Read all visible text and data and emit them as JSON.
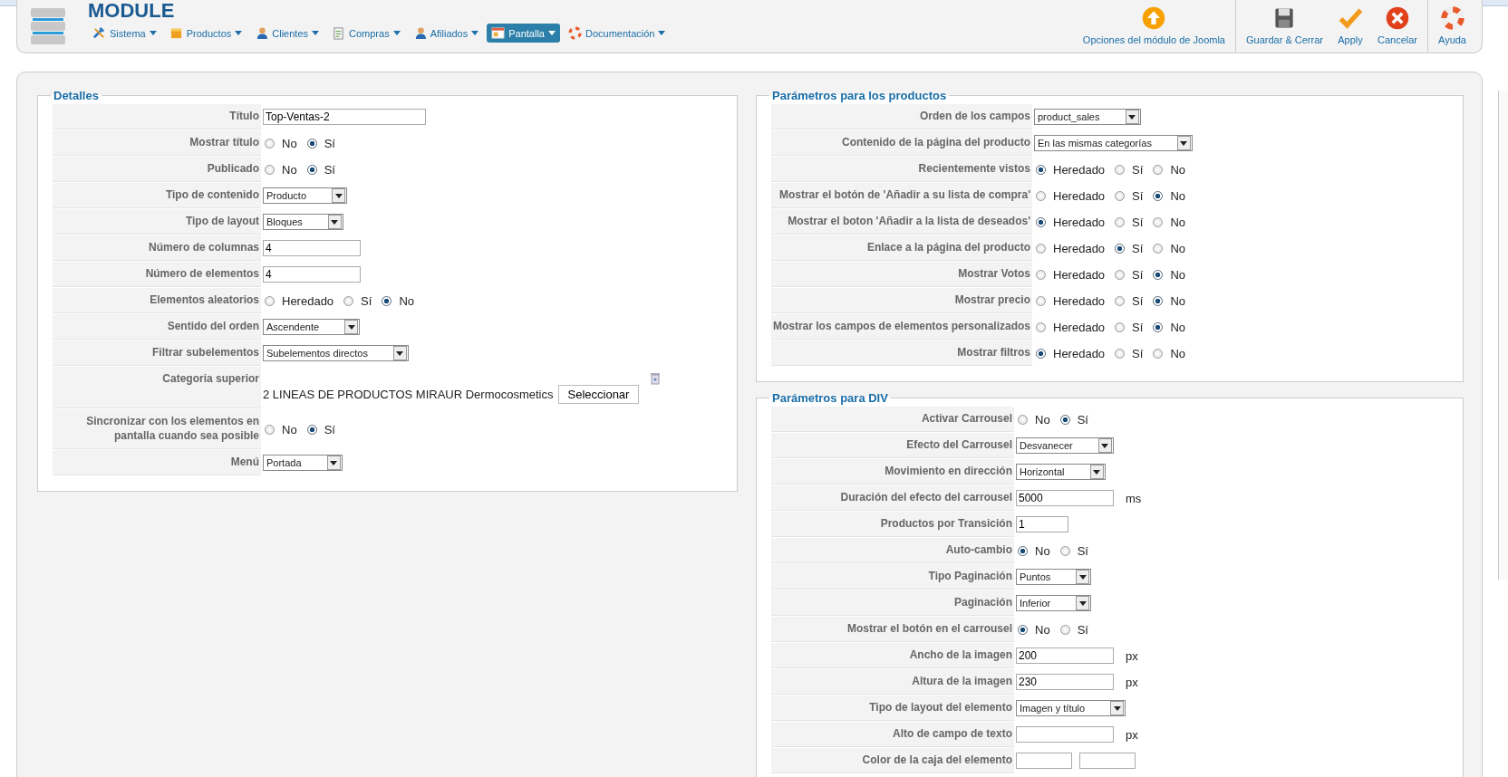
{
  "header": {
    "title": "MODULE",
    "menu": [
      {
        "label": "Sistema",
        "selected": false
      },
      {
        "label": "Productos",
        "selected": false
      },
      {
        "label": "Clientes",
        "selected": false
      },
      {
        "label": "Compras",
        "selected": false
      },
      {
        "label": "Afiliados",
        "selected": false
      },
      {
        "label": "Pantalla",
        "selected": true
      },
      {
        "label": "Documentación",
        "selected": false
      }
    ]
  },
  "toolbar": [
    [
      {
        "label": "Opciones del módulo de Joomla",
        "kind": "options"
      }
    ],
    [
      {
        "label": "Guardar & Cerrar",
        "kind": "save"
      },
      {
        "label": "Apply",
        "kind": "apply"
      },
      {
        "label": "Cancelar",
        "kind": "cancel"
      }
    ],
    [
      {
        "label": "Ayuda",
        "kind": "help"
      }
    ]
  ],
  "panels": [
    {
      "title": "Detalles",
      "rows": [
        {
          "label": "Título",
          "kind": "text",
          "value": "Top-Ventas-2"
        },
        {
          "label": "Mostrar título",
          "kind": "radio",
          "options": [
            {
              "label": "No",
              "selected": false
            },
            {
              "label": "Sí",
              "selected": true
            }
          ]
        },
        {
          "label": "Publicado",
          "kind": "radio",
          "options": [
            {
              "label": "No",
              "selected": false
            },
            {
              "label": "Sí",
              "selected": true
            }
          ]
        },
        {
          "label": "Tipo de contenido",
          "kind": "select",
          "value": "Producto"
        },
        {
          "label": "Tipo de layout",
          "kind": "select",
          "value": "Bloques"
        },
        {
          "label": "Número de columnas",
          "kind": "text",
          "value": "4"
        },
        {
          "label": "Número de elementos",
          "kind": "text",
          "value": "4"
        },
        {
          "label": "Elementos aleatorios",
          "kind": "radio",
          "options": [
            {
              "label": "Heredado",
              "selected": false
            },
            {
              "label": "Sí",
              "selected": false
            },
            {
              "label": "No",
              "selected": true
            }
          ]
        },
        {
          "label": "Sentido del orden",
          "kind": "select",
          "value": "Ascendente"
        },
        {
          "label": "Filtrar subelementos",
          "kind": "select",
          "value": "Subelementos directos"
        },
        {
          "label": "Categoria superior",
          "kind": "category",
          "value": "2 LINEAS DE PRODUCTOS MIRAUR Dermocosmetics",
          "button": "Seleccionar"
        },
        {
          "label": "Sincronizar con los elementos en pantalla cuando sea posible",
          "kind": "radio",
          "options": [
            {
              "label": "No",
              "selected": false
            },
            {
              "label": "Sí",
              "selected": true
            }
          ]
        },
        {
          "label": "Menú",
          "kind": "select",
          "value": "Portada"
        }
      ]
    },
    {
      "title": "Parámetros para los productos",
      "rows": [
        {
          "label": "Orden de los campos",
          "kind": "select",
          "value": "product_sales"
        },
        {
          "label": "Contenido de la página del producto",
          "kind": "select",
          "value": "En las mismas categorías"
        },
        {
          "label": "Recientemente vistos",
          "kind": "radio",
          "options": [
            {
              "label": "Heredado",
              "selected": true
            },
            {
              "label": "Sí",
              "selected": false
            },
            {
              "label": "No",
              "selected": false
            }
          ]
        },
        {
          "label": "Mostrar el botón de 'Añadir a su lista de compra'",
          "kind": "radio",
          "options": [
            {
              "label": "Heredado",
              "selected": false
            },
            {
              "label": "Sí",
              "selected": false
            },
            {
              "label": "No",
              "selected": true
            }
          ]
        },
        {
          "label": "Mostrar el boton 'Añadir a la lista de deseados'",
          "kind": "radio",
          "options": [
            {
              "label": "Heredado",
              "selected": true
            },
            {
              "label": "Sí",
              "selected": false
            },
            {
              "label": "No",
              "selected": false
            }
          ]
        },
        {
          "label": "Enlace a la página del producto",
          "kind": "radio",
          "options": [
            {
              "label": "Heredado",
              "selected": false
            },
            {
              "label": "Sí",
              "selected": true
            },
            {
              "label": "No",
              "selected": false
            }
          ]
        },
        {
          "label": "Mostrar Votos",
          "kind": "radio",
          "options": [
            {
              "label": "Heredado",
              "selected": false
            },
            {
              "label": "Sí",
              "selected": false
            },
            {
              "label": "No",
              "selected": true
            }
          ]
        },
        {
          "label": "Mostrar precio",
          "kind": "radio",
          "options": [
            {
              "label": "Heredado",
              "selected": false
            },
            {
              "label": "Sí",
              "selected": false
            },
            {
              "label": "No",
              "selected": true
            }
          ]
        },
        {
          "label": "Mostrar los campos de elementos personalizados",
          "kind": "radio",
          "options": [
            {
              "label": "Heredado",
              "selected": false
            },
            {
              "label": "Sí",
              "selected": false
            },
            {
              "label": "No",
              "selected": true
            }
          ]
        },
        {
          "label": "Mostrar filtros",
          "kind": "radio",
          "options": [
            {
              "label": "Heredado",
              "selected": true
            },
            {
              "label": "Sí",
              "selected": false
            },
            {
              "label": "No",
              "selected": false
            }
          ]
        }
      ]
    },
    {
      "title": "Parámetros para DIV",
      "rows": [
        {
          "label": "Activar Carrousel",
          "kind": "radio",
          "options": [
            {
              "label": "No",
              "selected": false
            },
            {
              "label": "Sí",
              "selected": true
            }
          ]
        },
        {
          "label": "Efecto del Carrousel",
          "kind": "select",
          "value": "Desvanecer"
        },
        {
          "label": "Movimiento en dirección",
          "kind": "select",
          "value": "Horizontal"
        },
        {
          "label": "Duración del efecto del carrousel",
          "kind": "text",
          "value": "5000",
          "unit": "ms"
        },
        {
          "label": "Productos por Transición",
          "kind": "text",
          "value": "1"
        },
        {
          "label": "Auto-cambio",
          "kind": "radio",
          "options": [
            {
              "label": "No",
              "selected": true
            },
            {
              "label": "Sí",
              "selected": false
            }
          ]
        },
        {
          "label": "Tipo Paginación",
          "kind": "select",
          "value": "Puntos"
        },
        {
          "label": "Paginación",
          "kind": "select",
          "value": "Inferior"
        },
        {
          "label": "Mostrar el botón en el carrousel",
          "kind": "radio",
          "options": [
            {
              "label": "No",
              "selected": true
            },
            {
              "label": "Sí",
              "selected": false
            }
          ]
        },
        {
          "label": "Ancho de la imagen",
          "kind": "text",
          "value": "200",
          "unit": "px"
        },
        {
          "label": "Altura de la imagen",
          "kind": "text",
          "value": "230",
          "unit": "px"
        },
        {
          "label": "Tipo de layout del elemento",
          "kind": "select",
          "value": "Imagen y título"
        },
        {
          "label": "Alto de campo de texto",
          "kind": "text",
          "unit": "px"
        },
        {
          "label": "Color de la caja del elemento",
          "kind": "pair"
        }
      ]
    }
  ]
}
